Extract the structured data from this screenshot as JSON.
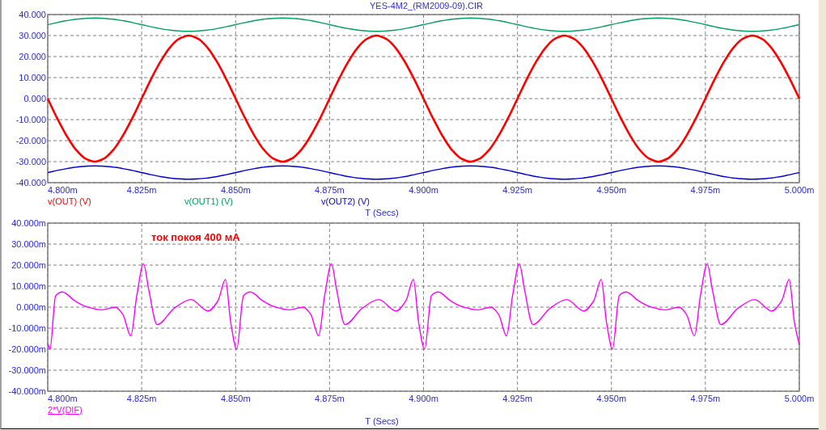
{
  "window": {
    "title": "YES-4M2_(RM2009-09).CIR"
  },
  "plots": [
    {
      "legend_underlined": false,
      "chart_data": {
        "type": "line",
        "xlabel": "T (Secs)",
        "grid": true,
        "xlim": [
          4.8,
          5.0
        ],
        "ylim": [
          -40,
          40
        ],
        "xticks": [
          {
            "value": 4.8,
            "label": "4.800m"
          },
          {
            "value": 4.825,
            "label": "4.825m"
          },
          {
            "value": 4.85,
            "label": "4.850m"
          },
          {
            "value": 4.875,
            "label": "4.875m"
          },
          {
            "value": 4.9,
            "label": "4.900m"
          },
          {
            "value": 4.925,
            "label": "4.925m"
          },
          {
            "value": 4.95,
            "label": "4.950m"
          },
          {
            "value": 4.975,
            "label": "4.975m"
          },
          {
            "value": 5.0,
            "label": "5.000m"
          }
        ],
        "yticks": [
          {
            "value": 40,
            "label": "40.000"
          },
          {
            "value": 30,
            "label": "30.000"
          },
          {
            "value": 20,
            "label": "20.000"
          },
          {
            "value": 10,
            "label": "10.000"
          },
          {
            "value": 0,
            "label": "0.000"
          },
          {
            "value": -10,
            "label": "-10.000"
          },
          {
            "value": -20,
            "label": "-20.000"
          },
          {
            "value": -30,
            "label": "-30.000"
          },
          {
            "value": -40,
            "label": "-40.000"
          }
        ],
        "x": [
          4.8,
          4.8025,
          4.805,
          4.8075,
          4.81,
          4.8125,
          4.815,
          4.8175,
          4.82,
          4.8225,
          4.825,
          4.8275,
          4.83,
          4.8325,
          4.835,
          4.8375,
          4.84,
          4.8425,
          4.845,
          4.8475,
          4.85,
          4.8525,
          4.855,
          4.8575,
          4.86,
          4.8625,
          4.865,
          4.8675,
          4.87,
          4.8725,
          4.875,
          4.8775,
          4.88,
          4.8825,
          4.885,
          4.8875,
          4.89,
          4.8925,
          4.895,
          4.8975,
          4.9,
          4.9025,
          4.905,
          4.9075,
          4.91,
          4.9125,
          4.915,
          4.9175,
          4.92,
          4.9225,
          4.925,
          4.9275,
          4.93,
          4.9325,
          4.935,
          4.9375,
          4.94,
          4.9425,
          4.945,
          4.9475,
          4.95,
          4.9525,
          4.955,
          4.9575,
          4.96,
          4.9625,
          4.965,
          4.9675,
          4.97,
          4.9725,
          4.975,
          4.9775,
          4.98,
          4.9825,
          4.985,
          4.9875,
          4.99,
          4.9925,
          4.995,
          4.9975,
          5.0
        ],
        "series": [
          {
            "name": "v(OUT) (V)",
            "color": "#ff0000",
            "values": [
              0,
              -9.3,
              -17.6,
              -24.3,
              -28.5,
              -30,
              -28.5,
              -24.3,
              -17.6,
              -9.3,
              0,
              9.3,
              17.6,
              24.3,
              28.5,
              30,
              28.5,
              24.3,
              17.6,
              9.3,
              0,
              -9.3,
              -17.6,
              -24.3,
              -28.5,
              -30,
              -28.5,
              -24.3,
              -17.6,
              -9.3,
              0,
              9.3,
              17.6,
              24.3,
              28.5,
              30,
              28.5,
              24.3,
              17.6,
              9.3,
              0,
              -9.3,
              -17.6,
              -24.3,
              -28.5,
              -30,
              -28.5,
              -24.3,
              -17.6,
              -9.3,
              0,
              9.3,
              17.6,
              24.3,
              28.5,
              30,
              28.5,
              24.3,
              17.6,
              9.3,
              0,
              -9.3,
              -17.6,
              -24.3,
              -28.5,
              -30,
              -28.5,
              -24.3,
              -17.6,
              -9.3,
              0,
              9.3,
              17.6,
              24.3,
              28.5,
              30,
              28.5,
              24.3,
              17.6,
              9.3,
              0
            ]
          },
          {
            "name": "v(OUT1) (V)",
            "color": "#00a060",
            "values": [
              35.2,
              36.2,
              37.1,
              37.8,
              38.2,
              38.4,
              38.2,
              37.8,
              37.1,
              36.2,
              35.2,
              34.2,
              33.3,
              32.6,
              32.2,
              32,
              32.2,
              32.6,
              33.3,
              34.2,
              35.2,
              36.2,
              37.1,
              37.8,
              38.2,
              38.4,
              38.2,
              37.8,
              37.1,
              36.2,
              35.2,
              34.2,
              33.3,
              32.6,
              32.2,
              32,
              32.2,
              32.6,
              33.3,
              34.2,
              35.2,
              36.2,
              37.1,
              37.8,
              38.2,
              38.4,
              38.2,
              37.8,
              37.1,
              36.2,
              35.2,
              34.2,
              33.3,
              32.6,
              32.2,
              32,
              32.2,
              32.6,
              33.3,
              34.2,
              35.2,
              36.2,
              37.1,
              37.8,
              38.2,
              38.4,
              38.2,
              37.8,
              37.1,
              36.2,
              35.2,
              34.2,
              33.3,
              32.6,
              32.2,
              32,
              32.2,
              32.6,
              33.3,
              34.2,
              35.2
            ]
          },
          {
            "name": "v(OUT2) (V)",
            "color": "#0000d0",
            "values": [
              -35.2,
              -34.2,
              -33.3,
              -32.6,
              -32.2,
              -32,
              -32.2,
              -32.6,
              -33.3,
              -34.2,
              -35.2,
              -36.2,
              -37.1,
              -37.8,
              -38.2,
              -38.4,
              -38.2,
              -37.8,
              -37.1,
              -36.2,
              -35.2,
              -34.2,
              -33.3,
              -32.6,
              -32.2,
              -32,
              -32.2,
              -32.6,
              -33.3,
              -34.2,
              -35.2,
              -36.2,
              -37.1,
              -37.8,
              -38.2,
              -38.4,
              -38.2,
              -37.8,
              -37.1,
              -36.2,
              -35.2,
              -34.2,
              -33.3,
              -32.6,
              -32.2,
              -32,
              -32.2,
              -32.6,
              -33.3,
              -34.2,
              -35.2,
              -36.2,
              -37.1,
              -37.8,
              -38.2,
              -38.4,
              -38.2,
              -37.8,
              -37.1,
              -36.2,
              -35.2,
              -34.2,
              -33.3,
              -32.6,
              -32.2,
              -32,
              -32.2,
              -32.6,
              -33.3,
              -34.2,
              -35.2,
              -36.2,
              -37.1,
              -37.8,
              -38.2,
              -38.4,
              -38.2,
              -37.8,
              -37.1,
              -36.2,
              -35.2
            ]
          }
        ]
      }
    },
    {
      "legend_underlined": true,
      "chart_data": {
        "type": "line",
        "xlabel": "T (Secs)",
        "grid": true,
        "xlim": [
          4.8,
          5.0
        ],
        "ylim": [
          -40,
          40
        ],
        "xticks": [
          {
            "value": 4.8,
            "label": "4.800m"
          },
          {
            "value": 4.825,
            "label": "4.825m"
          },
          {
            "value": 4.85,
            "label": "4.850m"
          },
          {
            "value": 4.875,
            "label": "4.875m"
          },
          {
            "value": 4.9,
            "label": "4.900m"
          },
          {
            "value": 4.925,
            "label": "4.925m"
          },
          {
            "value": 4.95,
            "label": "4.950m"
          },
          {
            "value": 4.975,
            "label": "4.975m"
          },
          {
            "value": 5.0,
            "label": "5.000m"
          }
        ],
        "yticks": [
          {
            "value": 40,
            "label": "40.000m"
          },
          {
            "value": 30,
            "label": "30.000m"
          },
          {
            "value": 20,
            "label": "20.000m"
          },
          {
            "value": 10,
            "label": "10.000m"
          },
          {
            "value": 0,
            "label": "0.000m"
          },
          {
            "value": -10,
            "label": "-10.000m"
          },
          {
            "value": -20,
            "label": "-20.000m"
          },
          {
            "value": -30,
            "label": "-30.000m"
          },
          {
            "value": -40,
            "label": "-40.000m"
          }
        ],
        "x": [
          4.8,
          4.8006,
          4.8021,
          4.8039,
          4.8072,
          4.81,
          4.8144,
          4.818,
          4.82,
          4.8221,
          4.8237,
          4.8255,
          4.8269,
          4.8291,
          4.8338,
          4.8381,
          4.8427,
          4.8453,
          4.8473,
          4.8487,
          4.8503,
          4.8521,
          4.8539,
          4.8572,
          4.86,
          4.8644,
          4.868,
          4.87,
          4.8721,
          4.8737,
          4.8755,
          4.8769,
          4.8791,
          4.8838,
          4.8881,
          4.8927,
          4.8953,
          4.8973,
          4.8987,
          4.9003,
          4.9021,
          4.9039,
          4.9072,
          4.91,
          4.9144,
          4.918,
          4.92,
          4.9221,
          4.9237,
          4.9255,
          4.9269,
          4.9291,
          4.9338,
          4.9381,
          4.9427,
          4.9453,
          4.9473,
          4.9487,
          4.9503,
          4.9521,
          4.9539,
          4.9572,
          4.96,
          4.9644,
          4.968,
          4.97,
          4.9721,
          4.9737,
          4.9755,
          4.9769,
          4.9791,
          4.9838,
          4.9881,
          4.9927,
          4.9953,
          4.9973,
          4.9987,
          5.0
        ],
        "series": [
          {
            "name": "2*V(DIF)",
            "color": "#ff00ff",
            "values": [
              -17.5,
              -20,
              5.5,
              7.2,
              3,
              0.4,
              -1.3,
              0,
              -3.5,
              -13.7,
              5.5,
              20.6,
              8,
              -8.3,
              -0.3,
              3.6,
              -1.8,
              3,
              13.2,
              -7.3,
              -20,
              5.5,
              7.2,
              3,
              0.4,
              -1.3,
              0,
              -3.5,
              -13.7,
              5.5,
              20.6,
              8,
              -8.3,
              -0.3,
              3.6,
              -1.8,
              3,
              13.2,
              -7.3,
              -20,
              5.5,
              7.2,
              3,
              0.4,
              -1.3,
              0,
              -3.5,
              -13.7,
              5.5,
              20.6,
              8,
              -8.3,
              -0.3,
              3.6,
              -1.8,
              3,
              13.2,
              -7.3,
              -20,
              5.5,
              7.2,
              3,
              0.4,
              -1.3,
              0,
              -3.5,
              -13.7,
              5.5,
              20.6,
              8,
              -8.3,
              -0.3,
              3.6,
              -1.8,
              3,
              13.2,
              -7.3,
              -18
            ]
          }
        ],
        "annotations": [
          "ток покоя 400 мА"
        ]
      }
    }
  ]
}
